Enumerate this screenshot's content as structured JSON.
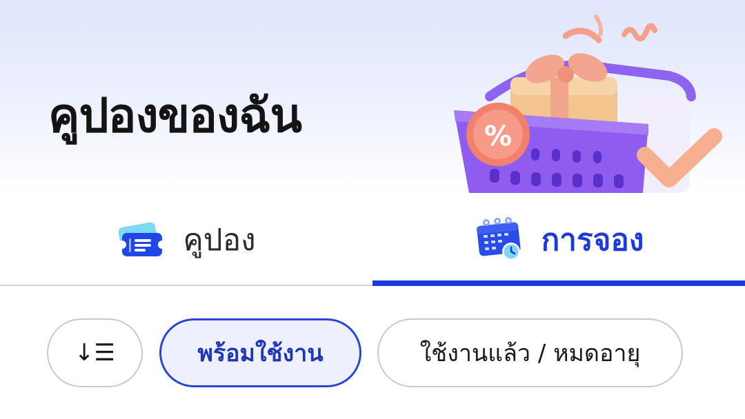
{
  "header": {
    "title": "คูปองของฉัน",
    "hero_illustration": "shopping-basket-gift-icon"
  },
  "tabs": [
    {
      "label": "คูปอง",
      "icon": "ticket-icon",
      "active": false
    },
    {
      "label": "การจอง",
      "icon": "calendar-clock-icon",
      "active": true
    }
  ],
  "filters": {
    "sort_icon": "sort-icon",
    "sort_glyph": "↓☰",
    "chips": [
      {
        "label": "พร้อมใช้งาน",
        "selected": true
      },
      {
        "label": "ใช้งานแล้ว / หมดอายุ",
        "selected": false
      }
    ]
  },
  "colors": {
    "accent": "#1e3ad9",
    "chip_selected_bg": "#eef1fd",
    "header_gradient_top": "#dfe5fb",
    "divider": "#d3d3d6"
  }
}
